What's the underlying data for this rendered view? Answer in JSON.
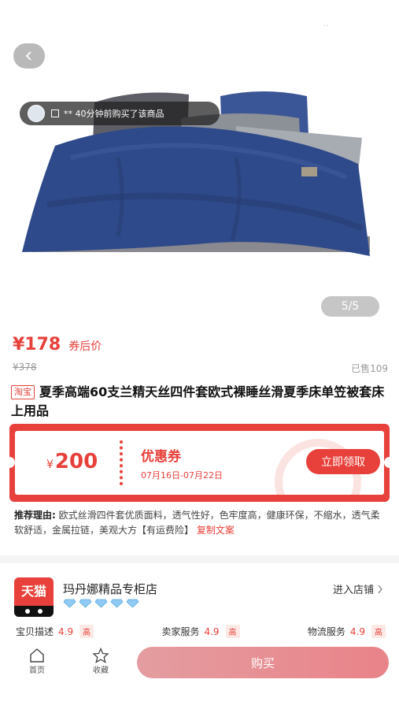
{
  "hero": {
    "toast_text": "** 40分钟前购买了该商品",
    "counter": "5/5"
  },
  "price": {
    "current": "¥178",
    "tag": "券后价",
    "original": "¥378",
    "sold": "已售109"
  },
  "title": {
    "badge": "淘宝",
    "text": "夏季高端60支兰精天丝四件套欧式裸睡丝滑夏季床单笠被套床上用品"
  },
  "coupon": {
    "currency": "¥",
    "amount": "200",
    "name": "优惠券",
    "date_range": "07月16日-07月22日",
    "button": "立即领取"
  },
  "reason": {
    "label": "推荐理由:",
    "text": "欧式丝滑四件套优质面料，透气性好，色牢度高，健康环保，不缩水，透气柔软舒适，金属拉链，美观大方【有运费险】",
    "copy": "复制文案"
  },
  "shop": {
    "logo_text": "天猫",
    "name": "玛丹娜精品专柜店",
    "enter": "进入店铺",
    "diamond_count": 5,
    "scores": [
      {
        "label": "宝贝描述",
        "value": "4.9",
        "level": "高"
      },
      {
        "label": "卖家服务",
        "value": "4.9",
        "level": "高"
      },
      {
        "label": "物流服务",
        "value": "4.9",
        "level": "高"
      }
    ]
  },
  "bottom": {
    "home": "首页",
    "favorite": "收藏",
    "buy": "购买"
  },
  "colors": {
    "accent": "#e8403a",
    "bedding": "#2f4a8a",
    "sheet_silver": "#9fa3aa"
  }
}
